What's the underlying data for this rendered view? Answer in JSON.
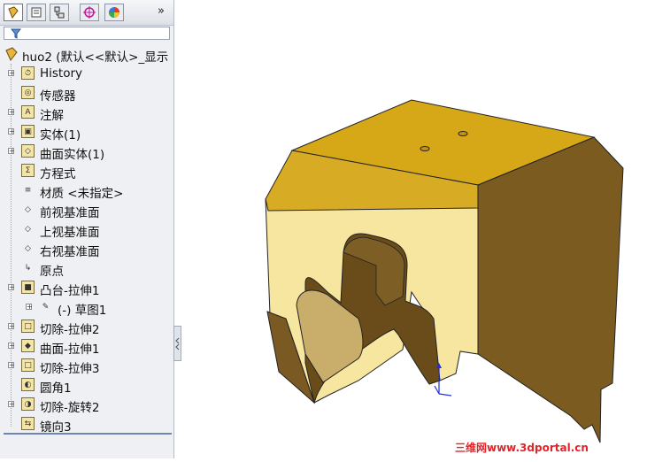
{
  "feature_tree": {
    "root_label": "huo2 (默认<<默认>_显示",
    "items": [
      {
        "label": "History",
        "icon": "history-icon",
        "expandable": true
      },
      {
        "label": "传感器",
        "icon": "sensor-icon",
        "expandable": false
      },
      {
        "label": "注解",
        "icon": "annotation-icon",
        "expandable": true
      },
      {
        "label": "实体(1)",
        "icon": "solid-body-icon",
        "expandable": true
      },
      {
        "label": "曲面实体(1)",
        "icon": "surface-body-icon",
        "expandable": true
      },
      {
        "label": "方程式",
        "icon": "equation-icon",
        "expandable": false
      },
      {
        "label": "材质 <未指定>",
        "icon": "material-icon",
        "expandable": false
      },
      {
        "label": "前视基准面",
        "icon": "plane-icon",
        "expandable": false
      },
      {
        "label": "上视基准面",
        "icon": "plane-icon",
        "expandable": false
      },
      {
        "label": "右视基准面",
        "icon": "plane-icon",
        "expandable": false
      },
      {
        "label": "原点",
        "icon": "origin-icon",
        "expandable": false
      },
      {
        "label": "凸台-拉伸1",
        "icon": "boss-extrude-icon",
        "expandable": true
      },
      {
        "label": "(-) 草图1",
        "icon": "sketch-icon",
        "expandable": true,
        "child": true
      },
      {
        "label": "切除-拉伸2",
        "icon": "cut-extrude-icon",
        "expandable": true
      },
      {
        "label": "曲面-拉伸1",
        "icon": "surface-extrude-icon",
        "expandable": true
      },
      {
        "label": "切除-拉伸3",
        "icon": "cut-extrude-icon",
        "expandable": true
      },
      {
        "label": "圆角1",
        "icon": "fillet-icon",
        "expandable": false
      },
      {
        "label": "切除-旋转2",
        "icon": "cut-revolve-icon",
        "expandable": true
      },
      {
        "label": "镜向3",
        "icon": "mirror-icon",
        "expandable": false
      }
    ]
  },
  "tabs": [
    "featuremanager-tab",
    "propertymanager-tab",
    "configurationmanager-tab",
    "dimxpert-tab",
    "display-manager-tab"
  ],
  "more_glyph": "»",
  "watermark": "三维网www.3dportal.cn",
  "colors": {
    "model_top": "#d6a817",
    "model_front": "#f7e6a0",
    "model_side": "#7a5a22",
    "tree_panel": "#eef0f3"
  }
}
